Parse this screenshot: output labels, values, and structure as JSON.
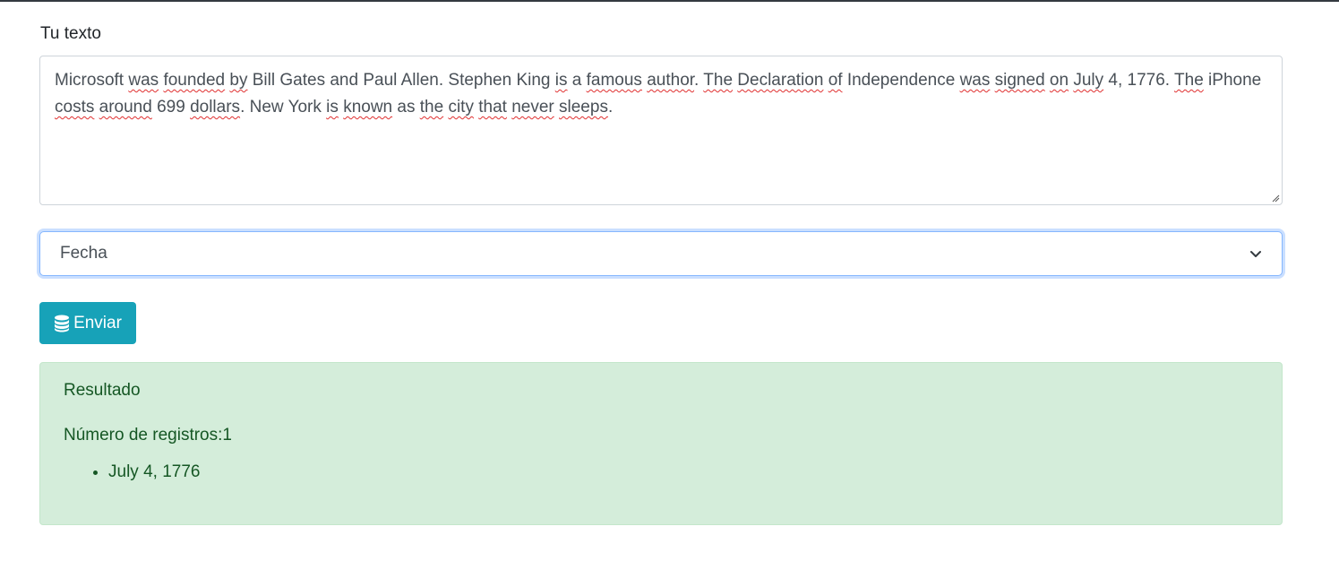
{
  "form": {
    "text_label": "Tu texto",
    "text_words": [
      {
        "t": "Microsoft ",
        "s": false
      },
      {
        "t": "was",
        "s": true
      },
      {
        "t": " ",
        "s": false
      },
      {
        "t": "founded",
        "s": true
      },
      {
        "t": " ",
        "s": false
      },
      {
        "t": "by",
        "s": true
      },
      {
        "t": " Bill Gates and Paul Allen. Stephen King ",
        "s": false
      },
      {
        "t": "is",
        "s": true
      },
      {
        "t": " a ",
        "s": false
      },
      {
        "t": "famous",
        "s": true
      },
      {
        "t": " ",
        "s": false
      },
      {
        "t": "author",
        "s": true
      },
      {
        "t": ". ",
        "s": false
      },
      {
        "t": "The",
        "s": true
      },
      {
        "t": " ",
        "s": false
      },
      {
        "t": "Declaration",
        "s": true
      },
      {
        "t": " ",
        "s": false
      },
      {
        "t": "of",
        "s": true
      },
      {
        "t": " Independence ",
        "s": false
      },
      {
        "t": "was",
        "s": true
      },
      {
        "t": " ",
        "s": false
      },
      {
        "t": "signed",
        "s": true
      },
      {
        "t": " ",
        "s": false
      },
      {
        "t": "on",
        "s": true
      },
      {
        "t": " ",
        "s": false
      },
      {
        "t": "July",
        "s": true
      },
      {
        "t": " 4, 1776. ",
        "s": false
      },
      {
        "t": "The",
        "s": true
      },
      {
        "t": " iPhone ",
        "s": false
      },
      {
        "t": "costs",
        "s": true
      },
      {
        "t": " ",
        "s": false
      },
      {
        "t": "around",
        "s": true
      },
      {
        "t": " 699 ",
        "s": false
      },
      {
        "t": "dollars",
        "s": true
      },
      {
        "t": ". New York ",
        "s": false
      },
      {
        "t": "is",
        "s": true
      },
      {
        "t": " ",
        "s": false
      },
      {
        "t": "known",
        "s": true
      },
      {
        "t": " as ",
        "s": false
      },
      {
        "t": "the",
        "s": true
      },
      {
        "t": " ",
        "s": false
      },
      {
        "t": "city",
        "s": true
      },
      {
        "t": " ",
        "s": false
      },
      {
        "t": "that",
        "s": true
      },
      {
        "t": " ",
        "s": false
      },
      {
        "t": "never",
        "s": true
      },
      {
        "t": " ",
        "s": false
      },
      {
        "t": "sleeps",
        "s": true
      },
      {
        "t": ".",
        "s": false
      }
    ],
    "select_value": "Fecha",
    "submit_label": "Enviar",
    "submit_icon": "database-icon"
  },
  "result": {
    "title": "Resultado",
    "count_text": "Número de registros:1",
    "items": [
      "July 4, 1776"
    ]
  },
  "colors": {
    "button": "#17a2b8",
    "alert_bg": "#d4edda",
    "alert_text": "#155724",
    "focus_border": "#86b7fe"
  }
}
